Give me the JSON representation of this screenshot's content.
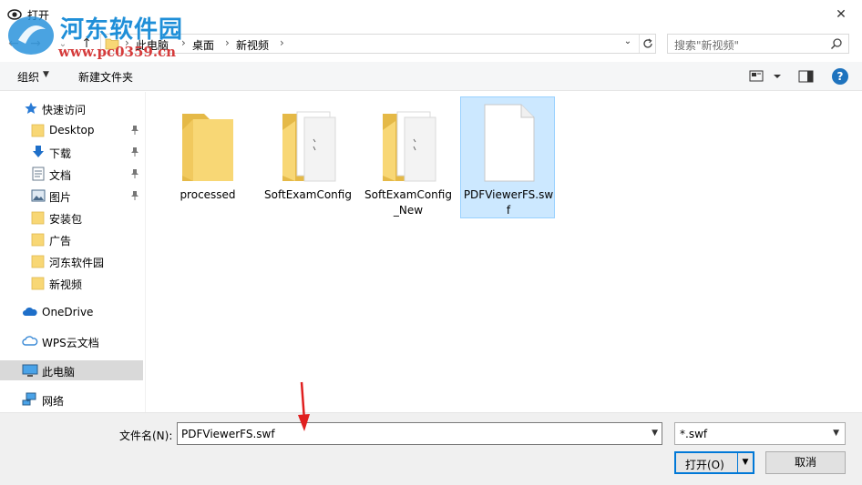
{
  "window": {
    "title": "打开",
    "close_glyph": "✕"
  },
  "watermark": {
    "title": "河东软件园",
    "url": "www.pc0359.cn"
  },
  "address": {
    "breadcrumbs": [
      "此电脑",
      "桌面",
      "新视频"
    ],
    "separator": "›",
    "dropdown_glyph": "⌄"
  },
  "search": {
    "placeholder": "搜索\"新视频\""
  },
  "toolbar": {
    "organize_label": "组织",
    "new_folder_label": "新建文件夹",
    "help_glyph": "?"
  },
  "sidebar": {
    "items": [
      {
        "label": "快速访问",
        "icon": "star-icon"
      },
      {
        "label": "Desktop",
        "icon": "folder-icon",
        "pinned": true
      },
      {
        "label": "下载",
        "icon": "download-icon",
        "pinned": true
      },
      {
        "label": "文档",
        "icon": "document-icon",
        "pinned": true
      },
      {
        "label": "图片",
        "icon": "pictures-icon",
        "pinned": true
      },
      {
        "label": "安装包",
        "icon": "folder-icon"
      },
      {
        "label": "广告",
        "icon": "folder-icon"
      },
      {
        "label": "河东软件园",
        "icon": "folder-icon"
      },
      {
        "label": "新视频",
        "icon": "folder-icon"
      },
      {
        "label": "OneDrive",
        "icon": "cloud-icon"
      },
      {
        "label": "WPS云文档",
        "icon": "cloud-outline-icon"
      },
      {
        "label": "此电脑",
        "icon": "computer-icon",
        "selected": true
      },
      {
        "label": "网络",
        "icon": "network-icon"
      }
    ]
  },
  "files": [
    {
      "name": "processed",
      "type": "folder"
    },
    {
      "name": "SoftExamConfig",
      "type": "folder-with-files"
    },
    {
      "name": "SoftExamConfig_New",
      "type": "folder-with-files"
    },
    {
      "name": "PDFViewerFS.swf",
      "type": "file",
      "selected": true
    }
  ],
  "bottom": {
    "filename_label": "文件名(N):",
    "filename_value": "PDFViewerFS.swf",
    "filter_value": "*.swf",
    "open_label": "打开(O)",
    "cancel_label": "取消"
  },
  "colors": {
    "accent": "#0078d7",
    "selection": "#cce8ff",
    "folder": "#f8d775",
    "arrow": "#e02020"
  }
}
